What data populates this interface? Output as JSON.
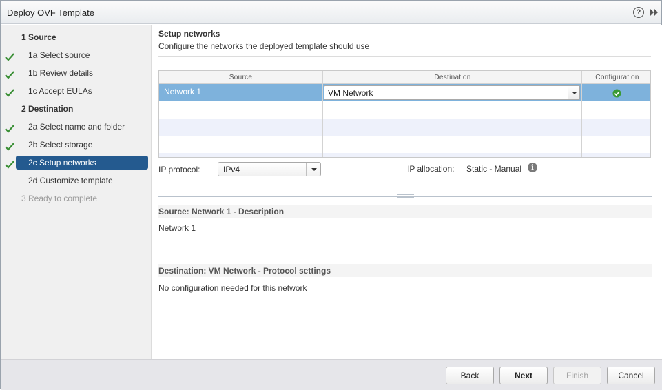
{
  "window": {
    "title": "Deploy OVF Template"
  },
  "nav": {
    "items": [
      {
        "label": "1  Source"
      },
      {
        "label": "1a  Select source"
      },
      {
        "label": "1b  Review details"
      },
      {
        "label": "1c  Accept EULAs"
      },
      {
        "label": "2  Destination"
      },
      {
        "label": "2a  Select name and folder"
      },
      {
        "label": "2b  Select storage"
      },
      {
        "label": "2c  Setup networks"
      },
      {
        "label": "2d  Customize template"
      },
      {
        "label": "3  Ready to complete"
      }
    ]
  },
  "main": {
    "title": "Setup networks",
    "subtitle": "Configure the networks the deployed template should use",
    "grid": {
      "columns": [
        "Source",
        "Destination",
        "Configuration"
      ],
      "rows": [
        {
          "source": "Network 1",
          "destination": "VM Network",
          "configuration": "ok"
        }
      ]
    },
    "ip_protocol": {
      "label": "IP protocol:",
      "value": "IPv4"
    },
    "ip_allocation": {
      "label": "IP allocation:",
      "value": "Static - Manual"
    },
    "source_details": {
      "title": "Source: Network 1 - Description",
      "body": "Network 1"
    },
    "destination_details": {
      "title": "Destination: VM Network - Protocol settings",
      "body": "No configuration needed for this network"
    }
  },
  "footer": {
    "back": "Back",
    "next": "Next",
    "finish": "Finish",
    "cancel": "Cancel"
  },
  "colors": {
    "selected_nav": "#245a8f",
    "selected_row": "#7eb2dc",
    "check_green": "#3a8f35"
  }
}
